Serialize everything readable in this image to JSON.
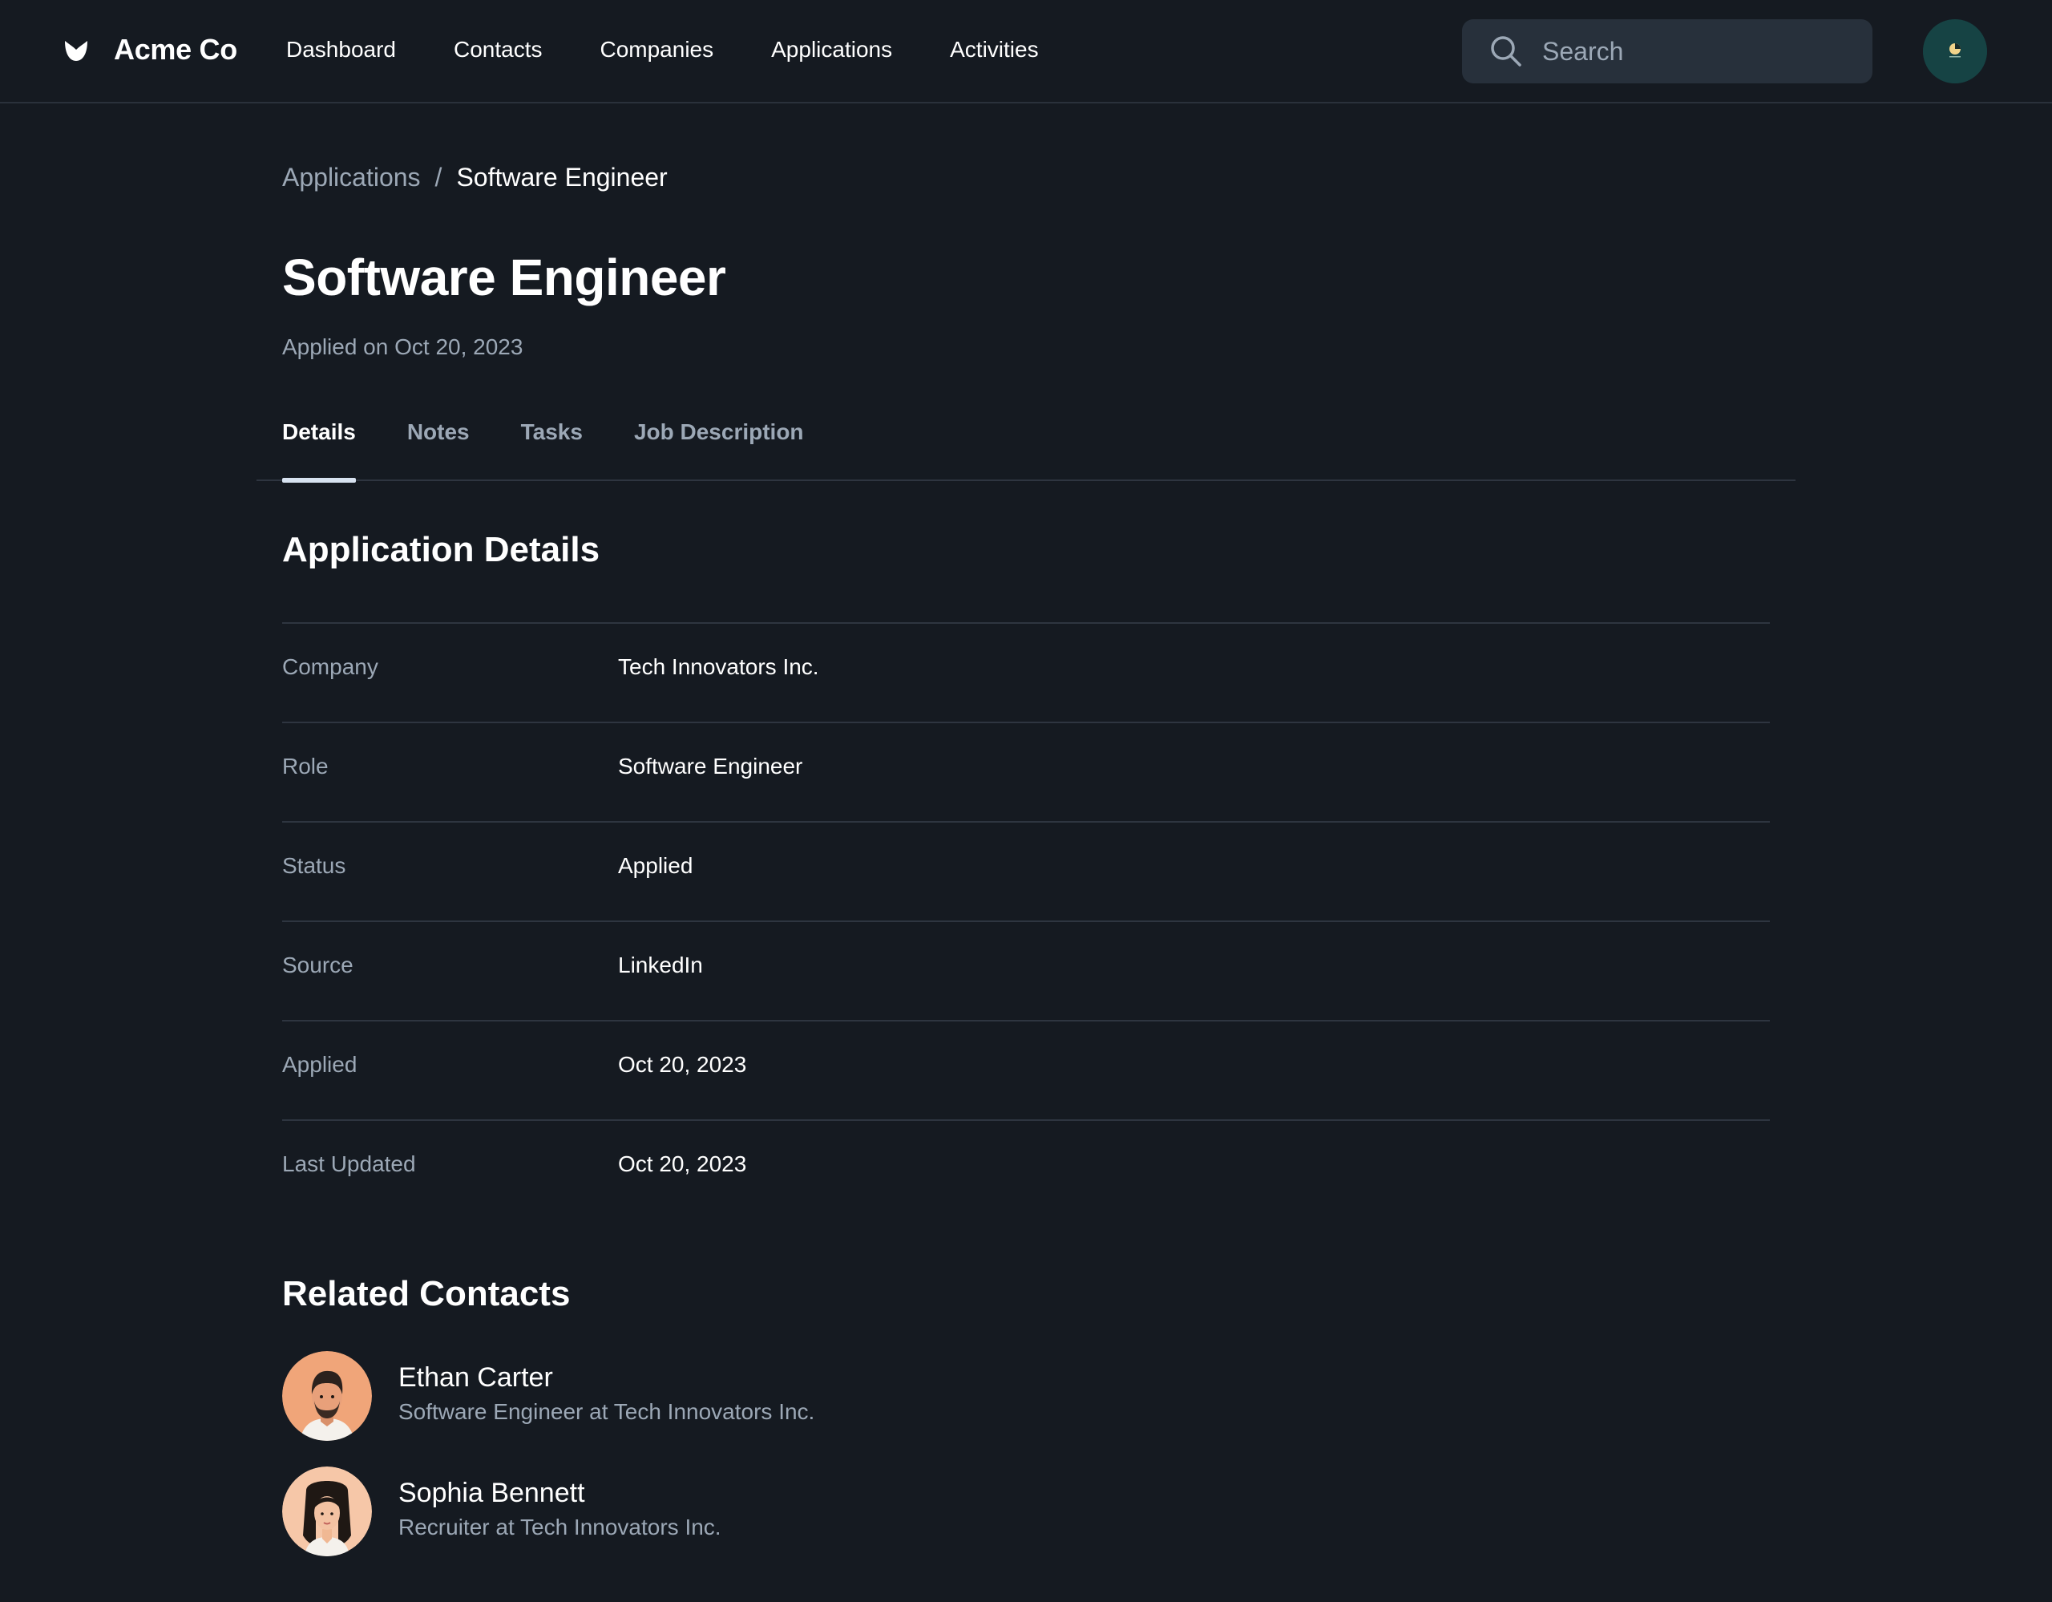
{
  "brand": {
    "name": "Acme Co",
    "logo_icon": "tulip-logo-icon"
  },
  "nav": {
    "items": [
      {
        "label": "Dashboard"
      },
      {
        "label": "Contacts"
      },
      {
        "label": "Companies"
      },
      {
        "label": "Applications"
      },
      {
        "label": "Activities"
      }
    ]
  },
  "search": {
    "placeholder": "Search",
    "value": "",
    "icon": "search-icon"
  },
  "user": {
    "avatar_icon": "user-avatar"
  },
  "breadcrumb": {
    "parent": "Applications",
    "separator": "/",
    "current": "Software Engineer"
  },
  "page": {
    "title": "Software Engineer",
    "subtitle": "Applied on Oct 20, 2023"
  },
  "tabs": {
    "items": [
      {
        "label": "Details",
        "active": true
      },
      {
        "label": "Notes",
        "active": false
      },
      {
        "label": "Tasks",
        "active": false
      },
      {
        "label": "Job Description",
        "active": false
      }
    ]
  },
  "details": {
    "title": "Application Details",
    "rows": [
      {
        "label": "Company",
        "value": "Tech Innovators Inc."
      },
      {
        "label": "Role",
        "value": "Software Engineer"
      },
      {
        "label": "Status",
        "value": "Applied"
      },
      {
        "label": "Source",
        "value": "LinkedIn"
      },
      {
        "label": "Applied",
        "value": "Oct 20, 2023"
      },
      {
        "label": "Last Updated",
        "value": "Oct 20, 2023"
      }
    ]
  },
  "contacts": {
    "title": "Related Contacts",
    "items": [
      {
        "name": "Ethan Carter",
        "subtitle": "Software Engineer at Tech Innovators Inc.",
        "avatar": "male-avatar-icon"
      },
      {
        "name": "Sophia Bennett",
        "subtitle": "Recruiter at Tech Innovators Inc.",
        "avatar": "female-avatar-icon"
      }
    ]
  },
  "colors": {
    "background": "#151a21",
    "text": "#ffffff",
    "muted_text": "#9ca8b6",
    "search_bg": "#27303b",
    "divider": "#2e3540",
    "tab_indicator": "#d7e2f0",
    "avatar_bg": "#164344"
  }
}
